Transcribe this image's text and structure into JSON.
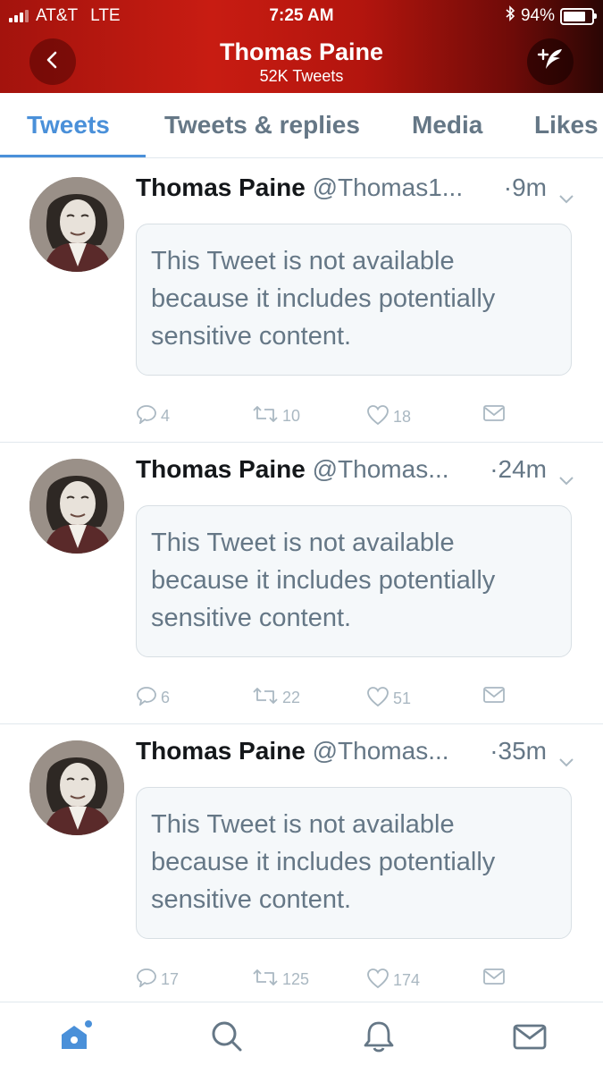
{
  "status_bar": {
    "carrier": "AT&T",
    "network": "LTE",
    "time": "7:25 AM",
    "battery": "94%",
    "battery_level": 0.94
  },
  "header": {
    "title": "Thomas Paine",
    "subtitle": "52K Tweets",
    "back_icon": "chevron-left-icon",
    "compose_icon": "compose-quill-icon",
    "gradient_colors": [
      "#a3130d",
      "#c81c12",
      "#2a0604"
    ]
  },
  "tabs": [
    {
      "label": "Tweets",
      "active": true
    },
    {
      "label": "Tweets & replies",
      "active": false
    },
    {
      "label": "Media",
      "active": false
    },
    {
      "label": "Likes",
      "active": false
    }
  ],
  "accent_color": "#4a90d9",
  "tweets": [
    {
      "name": "Thomas Paine",
      "handle": "@Thomas1...",
      "time": "·9m",
      "notice": "This Tweet is not available because it includes potentially sensitive content.",
      "replies": "4",
      "retweets": "10",
      "likes": "18"
    },
    {
      "name": "Thomas Paine",
      "handle": "@Thomas...",
      "time": "·24m",
      "notice": "This Tweet is not available because it includes potentially sensitive content.",
      "replies": "6",
      "retweets": "22",
      "likes": "51"
    },
    {
      "name": "Thomas Paine",
      "handle": "@Thomas...",
      "time": "·35m",
      "notice": "This Tweet is not available because it includes potentially sensitive content.",
      "replies": "17",
      "retweets": "125",
      "likes": "174"
    }
  ],
  "bottom_nav": [
    {
      "icon": "home-icon",
      "active": true
    },
    {
      "icon": "search-icon",
      "active": false
    },
    {
      "icon": "notifications-bell-icon",
      "active": false
    },
    {
      "icon": "messages-envelope-icon",
      "active": false
    }
  ]
}
